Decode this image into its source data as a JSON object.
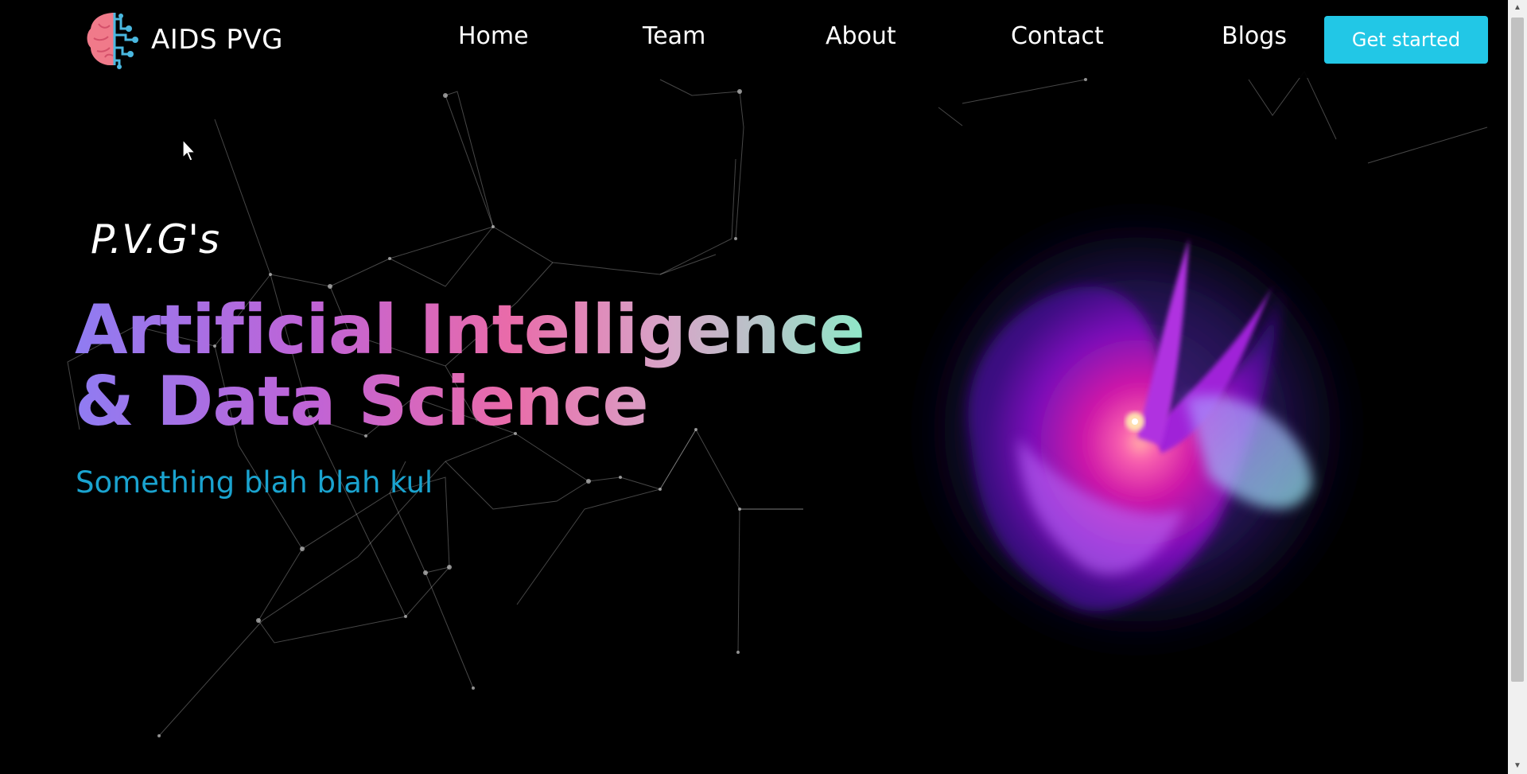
{
  "brand": {
    "name": "AIDS PVG",
    "logo_icon": "brain-circuit-icon"
  },
  "nav": {
    "items": [
      {
        "label": "Home"
      },
      {
        "label": "Team"
      },
      {
        "label": "About"
      },
      {
        "label": "Contact"
      },
      {
        "label": "Blogs"
      }
    ],
    "cta_label": "Get started"
  },
  "hero": {
    "pre_title": "P.V.G's",
    "title_line1": "Artificial Intelligence",
    "title_line2": "& Data Science",
    "tagline": "Something blah blah kul"
  },
  "colors": {
    "background": "#000000",
    "accent": "#22c7e6",
    "tagline": "#1aa3cf",
    "gradient_start": "#8f7cf2",
    "gradient_mid": "#e96ba9",
    "gradient_end": "#8fe8c8"
  }
}
